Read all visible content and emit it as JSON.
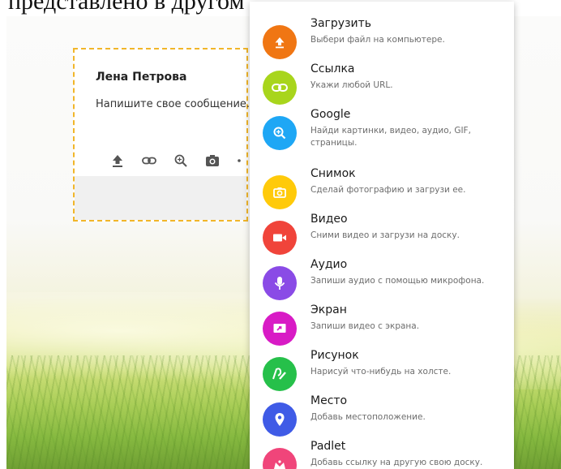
{
  "caption": "представлено в другом",
  "post": {
    "author": "Лена Петрова",
    "message": "Напишите свое сообщение...",
    "toolbar": [
      {
        "name": "upload-icon"
      },
      {
        "name": "link-icon"
      },
      {
        "name": "search-icon"
      },
      {
        "name": "camera-icon"
      },
      {
        "name": "more-icon"
      }
    ]
  },
  "menu": {
    "items": [
      {
        "title": "Загрузить",
        "desc": "Выбери файл на компьютере.",
        "color": "#f07613",
        "icon": "upload-icon"
      },
      {
        "title": "Ссылка",
        "desc": "Укажи любой URL.",
        "color": "#a8d51c",
        "icon": "link-icon"
      },
      {
        "title": "Google",
        "desc": "Найди картинки, видео, аудио, GIF, страницы.",
        "color": "#1ea7f5",
        "icon": "search-icon"
      },
      {
        "title": "Снимок",
        "desc": "Сделай фотографию и загрузи ее.",
        "color": "#ffca0a",
        "icon": "camera-icon"
      },
      {
        "title": "Видео",
        "desc": "Сними видео и загрузи на доску.",
        "color": "#f0443a",
        "icon": "video-icon"
      },
      {
        "title": "Аудио",
        "desc": "Запиши аудио с помощью микрофона.",
        "color": "#8a4be6",
        "icon": "microphone-icon"
      },
      {
        "title": "Экран",
        "desc": "Запиши видео с экрана.",
        "color": "#d81bc5",
        "icon": "screen-record-icon"
      },
      {
        "title": "Рисунок",
        "desc": "Нарисуй что-нибудь на холсте.",
        "color": "#26c04a",
        "icon": "draw-icon"
      },
      {
        "title": "Место",
        "desc": "Добавь местоположение.",
        "color": "#3f5be6",
        "icon": "location-icon"
      },
      {
        "title": "Padlet",
        "desc": "Добавь ссылку на другую свою доску.",
        "color": "#f0457a",
        "icon": "padlet-icon"
      }
    ]
  }
}
